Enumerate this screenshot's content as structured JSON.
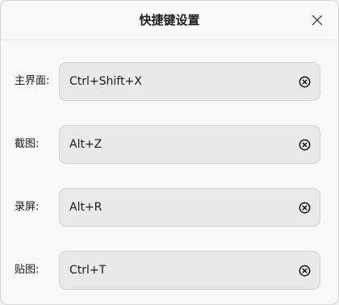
{
  "dialog": {
    "title": "快捷键设置",
    "close_icon": "close-icon"
  },
  "shortcuts": [
    {
      "label": "主界面:",
      "value": "Ctrl+Shift+X",
      "clear_icon": "clear-circle-x-icon"
    },
    {
      "label": "截图:",
      "value": "Alt+Z",
      "clear_icon": "clear-circle-x-icon"
    },
    {
      "label": "录屏:",
      "value": "Alt+R",
      "clear_icon": "clear-circle-x-icon"
    },
    {
      "label": "贴图:",
      "value": "Ctrl+T",
      "clear_icon": "clear-circle-x-icon"
    }
  ]
}
